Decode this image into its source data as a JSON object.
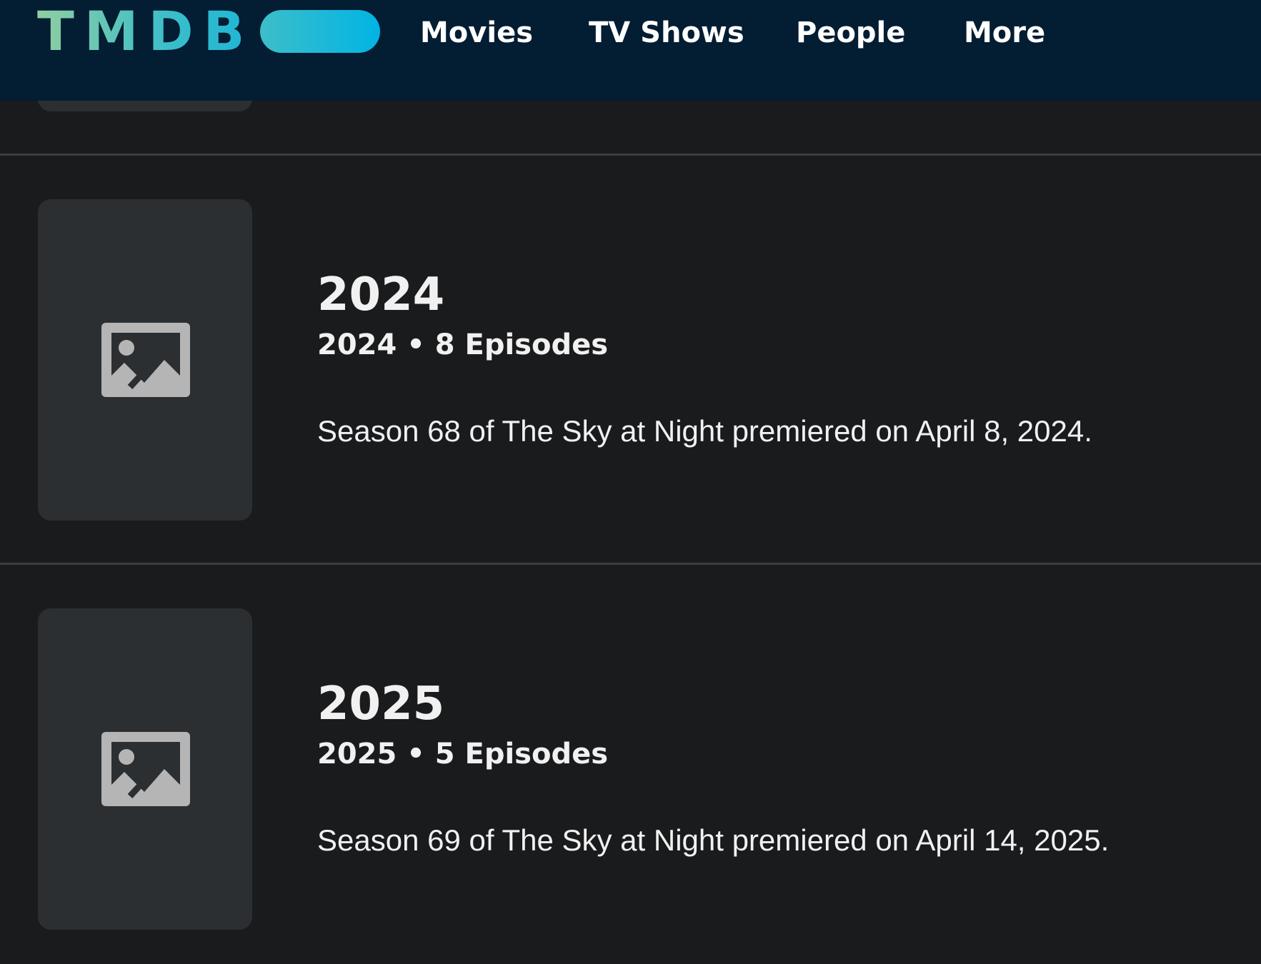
{
  "header": {
    "logo_text": "TMDB",
    "nav": [
      {
        "label": "Movies"
      },
      {
        "label": "TV Shows"
      },
      {
        "label": "People"
      },
      {
        "label": "More"
      }
    ]
  },
  "seasons": [
    {
      "title": "2024",
      "meta": "2024 • 8 Episodes",
      "overview": "Season 68 of The Sky at Night premiered on April 8, 2024.",
      "poster_icon": "image-placeholder-icon"
    },
    {
      "title": "2025",
      "meta": "2025 • 5 Episodes",
      "overview": "Season 69 of The Sky at Night premiered on April 14, 2025.",
      "poster_icon": "image-placeholder-icon"
    }
  ],
  "colors": {
    "header_bg": "#031d33",
    "page_bg": "#1a1b1d",
    "poster_bg": "#2c2f32",
    "divider": "#3b3e41",
    "icon": "#b5b5b5",
    "logo_gradient_start": "#90cea1",
    "logo_gradient_end": "#01b4e4"
  }
}
